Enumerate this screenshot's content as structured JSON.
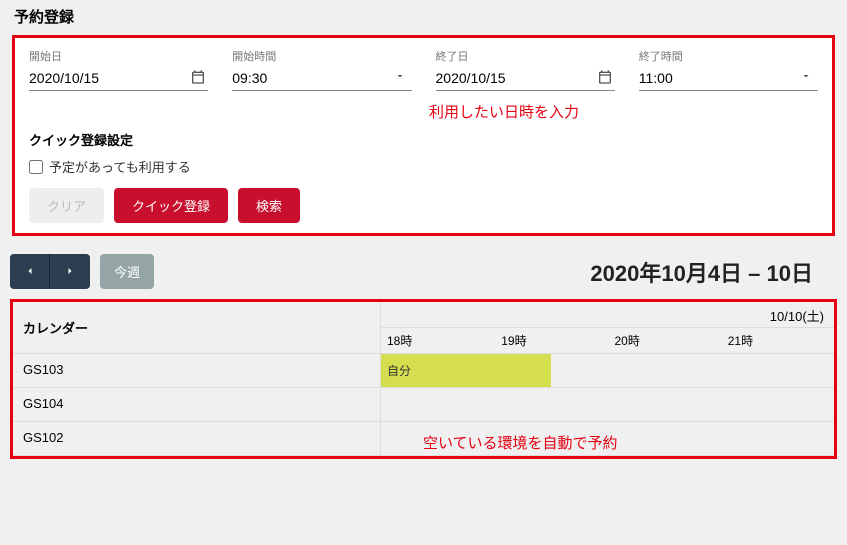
{
  "title": "予約登録",
  "fields": {
    "startDate": {
      "label": "開始日",
      "value": "2020/10/15"
    },
    "startTime": {
      "label": "開始時間",
      "value": "09:30"
    },
    "endDate": {
      "label": "終了日",
      "value": "2020/10/15"
    },
    "endTime": {
      "label": "終了時間",
      "value": "11:00"
    }
  },
  "annotation1": "利用したい日時を入力",
  "quick": {
    "title": "クイック登録設定",
    "checkboxLabel": "予定があっても利用する"
  },
  "buttons": {
    "clear": "クリア",
    "quickRegister": "クイック登録",
    "search": "検索"
  },
  "calendar": {
    "todayBtn": "今週",
    "range": "2020年10月4日 – 10日",
    "dayHeader": "10/10(土)",
    "nameHeader": "カレンダー",
    "hours": [
      "18時",
      "19時",
      "20時",
      "21時"
    ],
    "resources": [
      "GS103",
      "GS104",
      "GS102"
    ],
    "eventLabel": "自分"
  },
  "annotation2": "空いている環境を自動で予約"
}
